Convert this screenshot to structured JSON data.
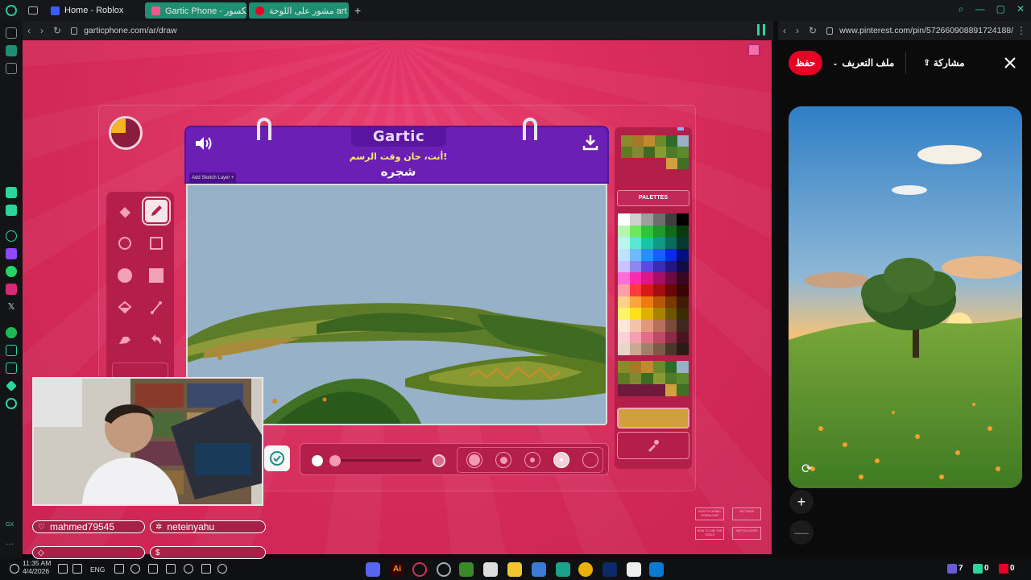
{
  "browser": {
    "tabs": [
      {
        "label": "Home - Roblox",
        "favicon_color": "#3b5bff"
      },
      {
        "label": "Gartic Phone - ناف المكسور",
        "favicon_color": "#f05a8c"
      },
      {
        "label": "مشور على اللوحة art class",
        "favicon_color": "#e60023"
      }
    ],
    "left_url": "garticphone.com/ar/draw",
    "right_url": "www.pinterest.com/pin/572660908891724188/"
  },
  "game": {
    "brand": "Gartic",
    "prompt_line1": "أنت، حان وقت الرسم!",
    "prompt_word": "شجره",
    "sketch_layer_label": "Add Sketch Layer +",
    "timer_remaining_fraction": 0.75,
    "palettes_label": "PALETTES",
    "selected_color": "#d0a03e",
    "tools": [
      "eraser",
      "pencil",
      "circle-outline",
      "square-outline",
      "circle-filled",
      "square-filled",
      "fill-bucket",
      "line",
      "stamp",
      "undo"
    ],
    "active_tool": "pencil",
    "brush_sizes": 5,
    "selected_brush_size": 4,
    "help_panels": [
      "HOW TO DRAW / DOWNLOAD",
      "SETTINGS",
      "HOW TO USE THE TOOLS",
      "SKETCH LAYER"
    ]
  },
  "streamer": {
    "names": [
      "mahmed79545",
      "neteinyahu",
      "",
      ""
    ]
  },
  "pinterest": {
    "save_label": "حفظ",
    "profile_label": "ملف التعريف",
    "share_label": "مشاركة",
    "zoom_in": "+",
    "zoom_out": "—"
  },
  "taskbar": {
    "time": "11:35 AM",
    "date": "4/4/2026",
    "lang": "ENG",
    "counts": [
      "7",
      "0",
      "0"
    ]
  }
}
